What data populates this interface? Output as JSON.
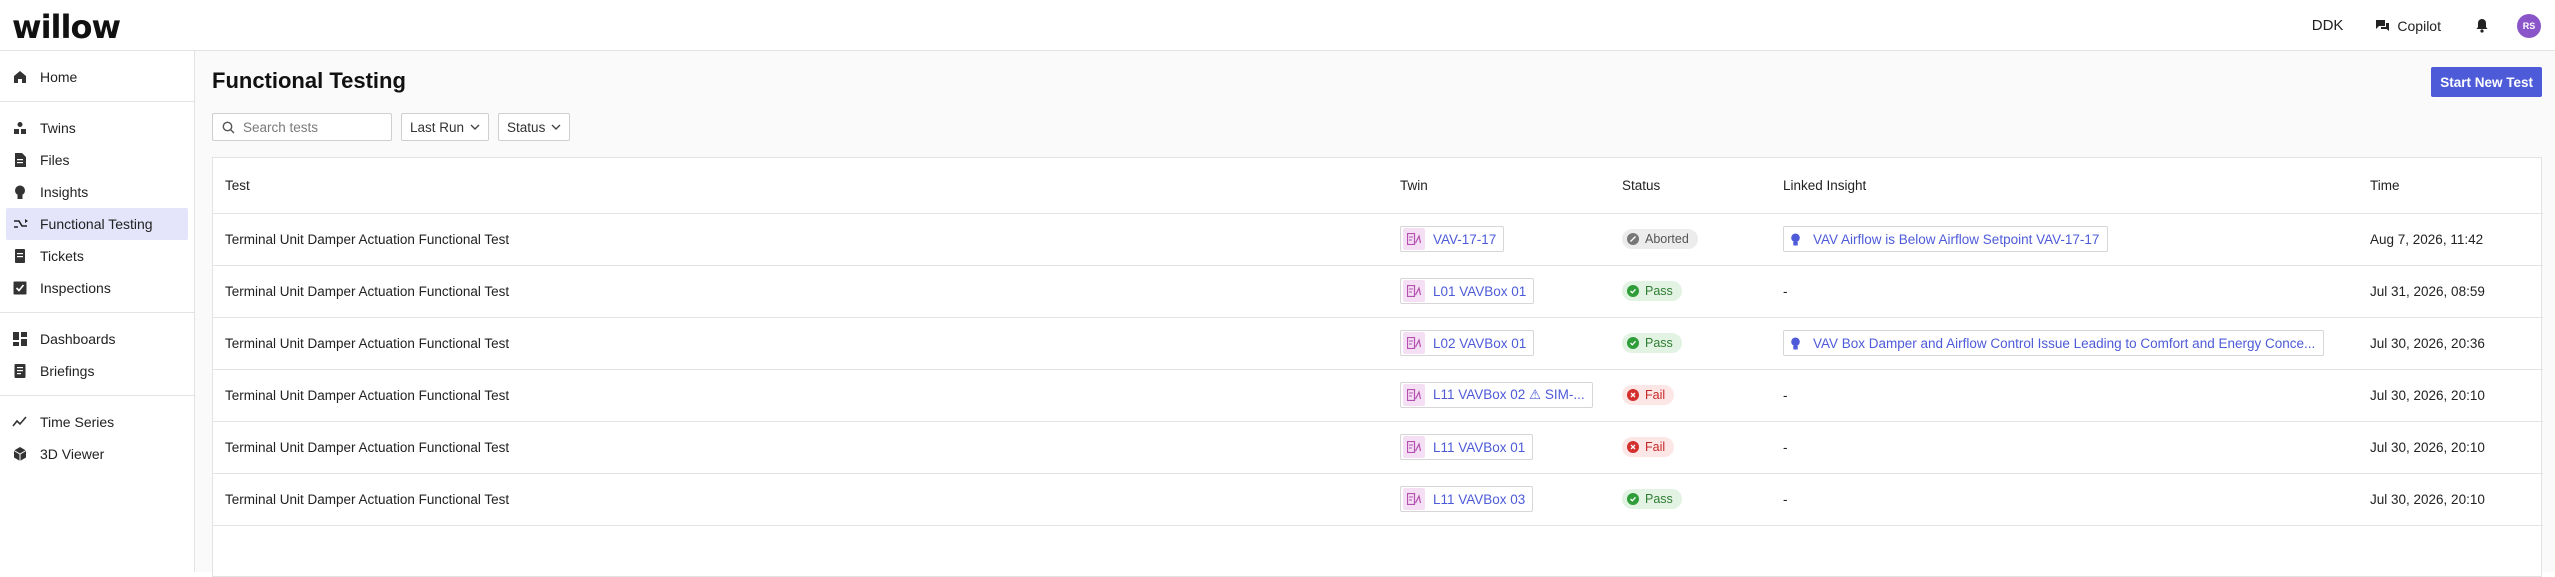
{
  "app": {
    "logo": "willow",
    "site": "DDK",
    "copilot_label": "Copilot",
    "avatar_initials": "RS",
    "accent": "#4d5bd8"
  },
  "sidebar": {
    "groups": [
      [
        {
          "label": "Home",
          "icon": "home-icon"
        }
      ],
      [
        {
          "label": "Twins",
          "icon": "twins-icon"
        },
        {
          "label": "Files",
          "icon": "file-icon"
        },
        {
          "label": "Insights",
          "icon": "lightbulb-icon"
        },
        {
          "label": "Functional Testing",
          "icon": "functional-testing-icon",
          "active": true
        },
        {
          "label": "Tickets",
          "icon": "ticket-icon"
        },
        {
          "label": "Inspections",
          "icon": "checkbox-icon"
        }
      ],
      [
        {
          "label": "Dashboards",
          "icon": "dashboard-icon"
        },
        {
          "label": "Briefings",
          "icon": "briefing-icon"
        }
      ],
      [
        {
          "label": "Time Series",
          "icon": "chart-line-icon"
        },
        {
          "label": "3D Viewer",
          "icon": "cube-icon"
        }
      ]
    ]
  },
  "main": {
    "title": "Functional Testing",
    "start_button": "Start New Test",
    "search_placeholder": "Search tests",
    "filter_last_run": "Last Run",
    "filter_status": "Status"
  },
  "table": {
    "headers": {
      "test": "Test",
      "twin": "Twin",
      "status": "Status",
      "insight": "Linked Insight",
      "time": "Time"
    },
    "rows": [
      {
        "test": "Terminal Unit Damper Actuation Functional Test",
        "twin": "VAV-17-17",
        "status": "Aborted",
        "status_kind": "aborted",
        "insight": "VAV Airflow is Below Airflow Setpoint VAV-17-17",
        "time": "Aug 7, 2026, 11:42"
      },
      {
        "test": "Terminal Unit Damper Actuation Functional Test",
        "twin": "L01 VAVBox 01",
        "status": "Pass",
        "status_kind": "pass",
        "insight": "-",
        "time": "Jul 31, 2026, 08:59"
      },
      {
        "test": "Terminal Unit Damper Actuation Functional Test",
        "twin": "L02 VAVBox 01",
        "status": "Pass",
        "status_kind": "pass",
        "insight": "VAV Box Damper and Airflow Control Issue Leading to Comfort and Energy Conce...",
        "time": "Jul 30, 2026, 20:36"
      },
      {
        "test": "Terminal Unit Damper Actuation Functional Test",
        "twin": "L11 VAVBox 02 ⚠ SIM-...",
        "status": "Fail",
        "status_kind": "fail",
        "insight": "-",
        "time": "Jul 30, 2026, 20:10"
      },
      {
        "test": "Terminal Unit Damper Actuation Functional Test",
        "twin": "L11 VAVBox 01",
        "status": "Fail",
        "status_kind": "fail",
        "insight": "-",
        "time": "Jul 30, 2026, 20:10"
      },
      {
        "test": "Terminal Unit Damper Actuation Functional Test",
        "twin": "L11 VAVBox 03",
        "status": "Pass",
        "status_kind": "pass",
        "insight": "-",
        "time": "Jul 30, 2026, 20:10"
      }
    ]
  }
}
